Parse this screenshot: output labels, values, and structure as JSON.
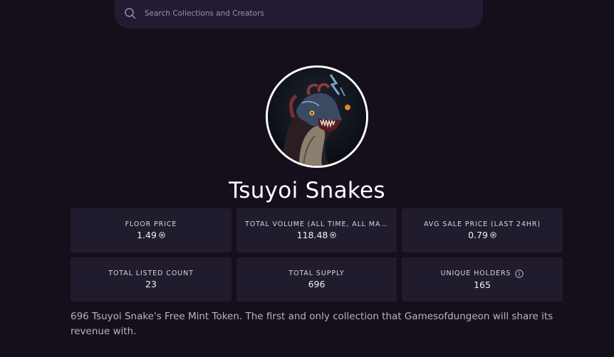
{
  "search": {
    "placeholder": "Search Collections and Creators",
    "icon": "search-icon"
  },
  "collection": {
    "name": "Tsuyoi Snakes",
    "avatar_icon": "snake-avatar"
  },
  "stats": [
    {
      "label": "FLOOR PRICE",
      "value": "1.49",
      "currency_icon": "solana-icon"
    },
    {
      "label": "TOTAL VOLUME (ALL TIME, ALL MARKETPLACES)",
      "value": "118.48",
      "currency_icon": "solana-icon"
    },
    {
      "label": "AVG SALE PRICE (LAST 24HR)",
      "value": "0.79",
      "currency_icon": "solana-icon"
    },
    {
      "label": "TOTAL LISTED COUNT",
      "value": "23"
    },
    {
      "label": "TOTAL SUPPLY",
      "value": "696"
    },
    {
      "label": "UNIQUE HOLDERS",
      "value": "165",
      "info_icon": "info-icon"
    }
  ],
  "description": "696 Tsuyoi Snake's Free Mint Token. The first and only collection that Gamesofdungeon will share its revenue with.",
  "colors": {
    "background": "#150f1b",
    "card": "#211c2d",
    "search": "#241a33"
  }
}
